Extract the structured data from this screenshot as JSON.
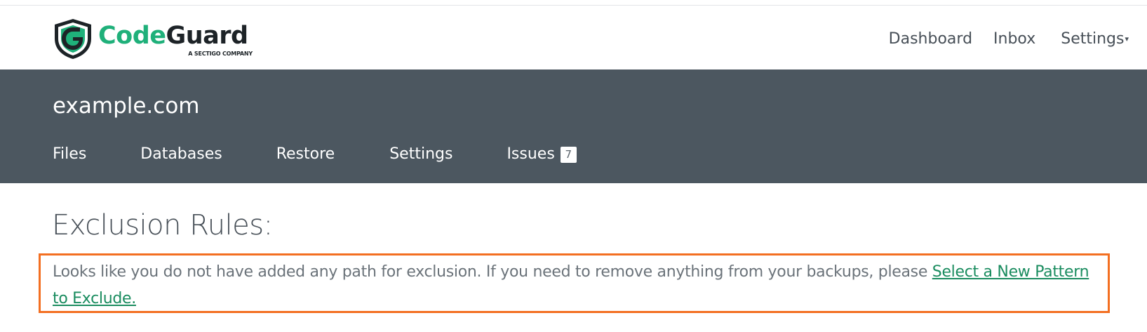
{
  "brand": {
    "name_part1": "Code",
    "name_part2": "Guard",
    "tagline": "A SECTIGO COMPANY",
    "logo_icon": "shield-logo-icon",
    "colors": {
      "green": "#1fb07a",
      "dark": "#1d2327"
    }
  },
  "topnav": {
    "items": [
      {
        "label": "Dashboard"
      },
      {
        "label": "Inbox"
      },
      {
        "label": "Settings",
        "caret": "▾"
      }
    ]
  },
  "site": {
    "title": "example.com",
    "tabs": [
      {
        "label": "Files"
      },
      {
        "label": "Databases"
      },
      {
        "label": "Restore"
      },
      {
        "label": "Settings"
      },
      {
        "label": "Issues",
        "badge": "7"
      }
    ],
    "bar_color": "#4c5760"
  },
  "main": {
    "heading": "Exclusion Rules:",
    "notice": {
      "text": "Looks like you do not have added any path for exclusion. If you need to remove anything from your backups, please ",
      "link_label": "Select a New Pattern to Exclude.",
      "highlight_color": "#f36f21",
      "link_color": "#1a8c5f"
    }
  }
}
